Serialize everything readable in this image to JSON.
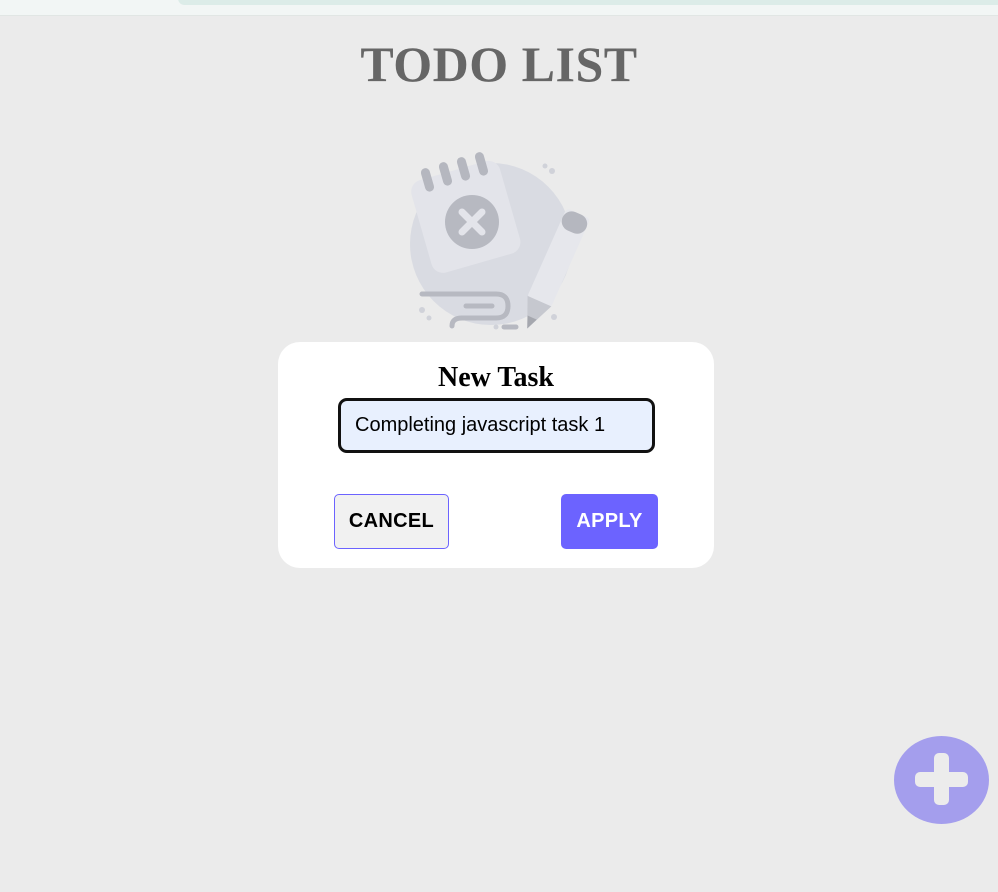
{
  "page": {
    "title": "TODO LIST"
  },
  "modal": {
    "title": "New Task",
    "input_value": "Completing javascript task 1",
    "cancel_label": "CANCEL",
    "apply_label": "APPLY"
  },
  "icons": {
    "empty_state": "empty-notepad-illustration",
    "fab": "plus-icon"
  },
  "colors": {
    "background": "#ebebeb",
    "accent": "#6c63ff",
    "fab": "#a49eed",
    "title": "#666666",
    "input_background": "#e8f0fe"
  }
}
